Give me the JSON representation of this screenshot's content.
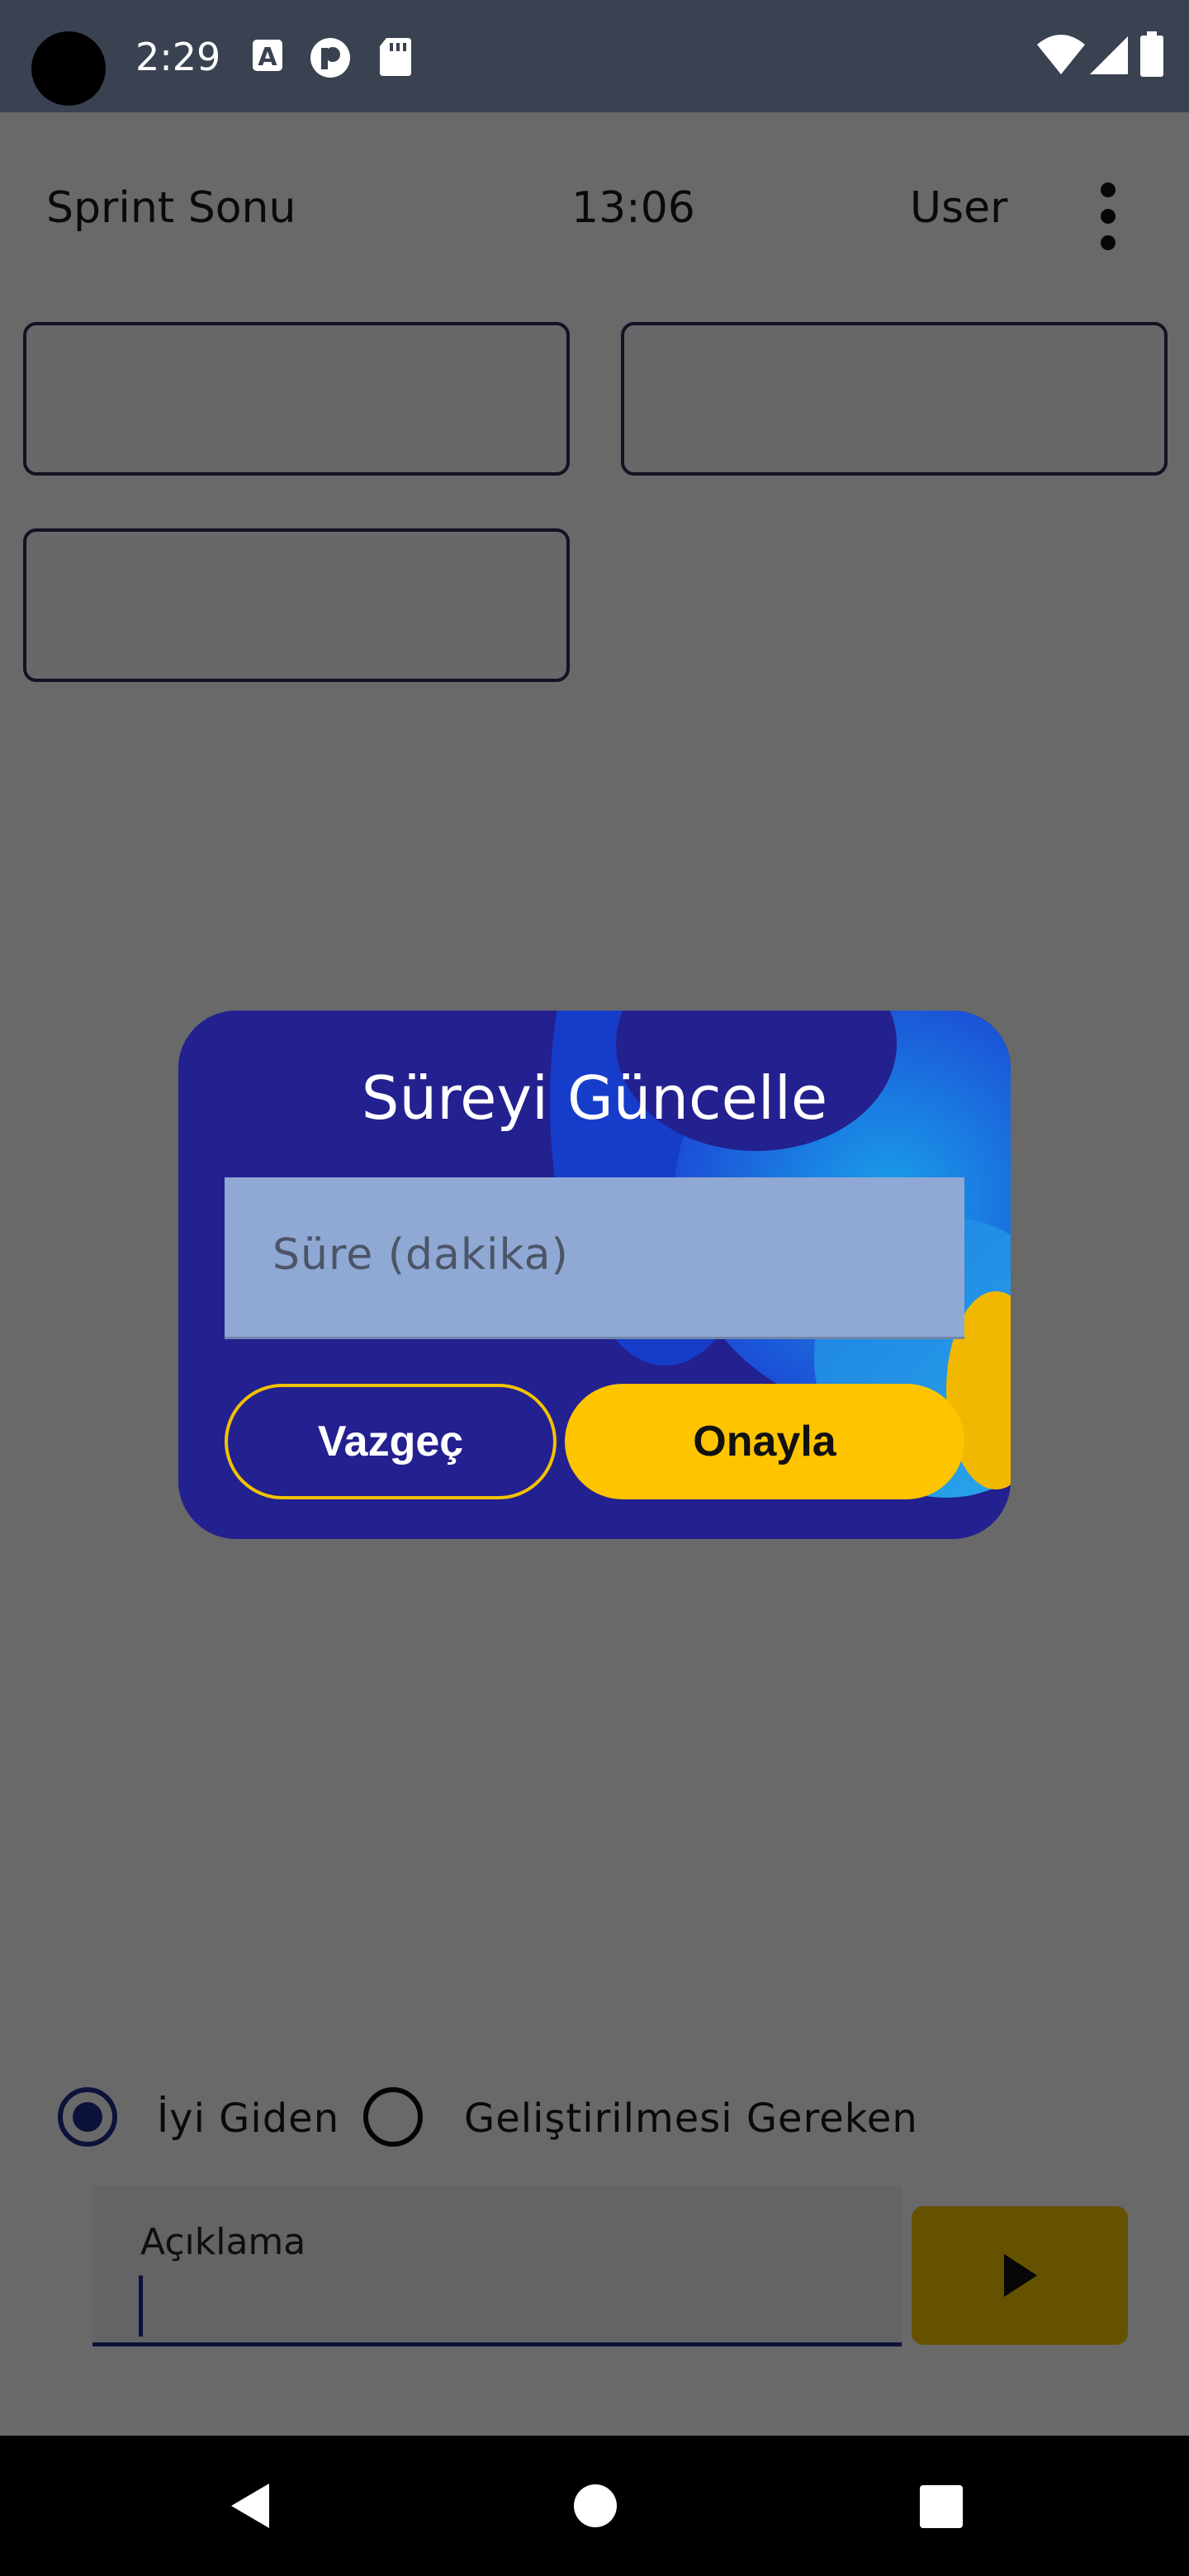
{
  "status_bar": {
    "time": "2:29",
    "icons": [
      "camera-cutout",
      "font-a-icon",
      "p-app-icon",
      "sd-card-icon",
      "wifi-icon",
      "signal-icon",
      "battery-icon"
    ]
  },
  "top_bar": {
    "title": "Sprint Sonu",
    "clock": "13:06",
    "user": "User",
    "menu_icon": "more-vert-icon"
  },
  "cards_count": 3,
  "radio_options": [
    {
      "label": "İyi Giden",
      "selected": true
    },
    {
      "label": "Geliştirilmesi Gereken",
      "selected": false
    }
  ],
  "description": {
    "label": "Açıklama",
    "value": ""
  },
  "send_button": {
    "icon": "play-arrow-icon"
  },
  "dialog": {
    "title": "Süreyi Güncelle",
    "input_placeholder": "Süre (dakika)",
    "cancel_label": "Vazgeç",
    "confirm_label": "Onayla"
  },
  "nav_bar": {
    "icons": [
      "back-icon",
      "home-icon",
      "recents-icon"
    ]
  },
  "colors": {
    "dialog_bg": "#23208f",
    "accent_yellow": "#ffc400",
    "primary_blue": "#1f2b8a",
    "status_bar": "#3a4150"
  }
}
